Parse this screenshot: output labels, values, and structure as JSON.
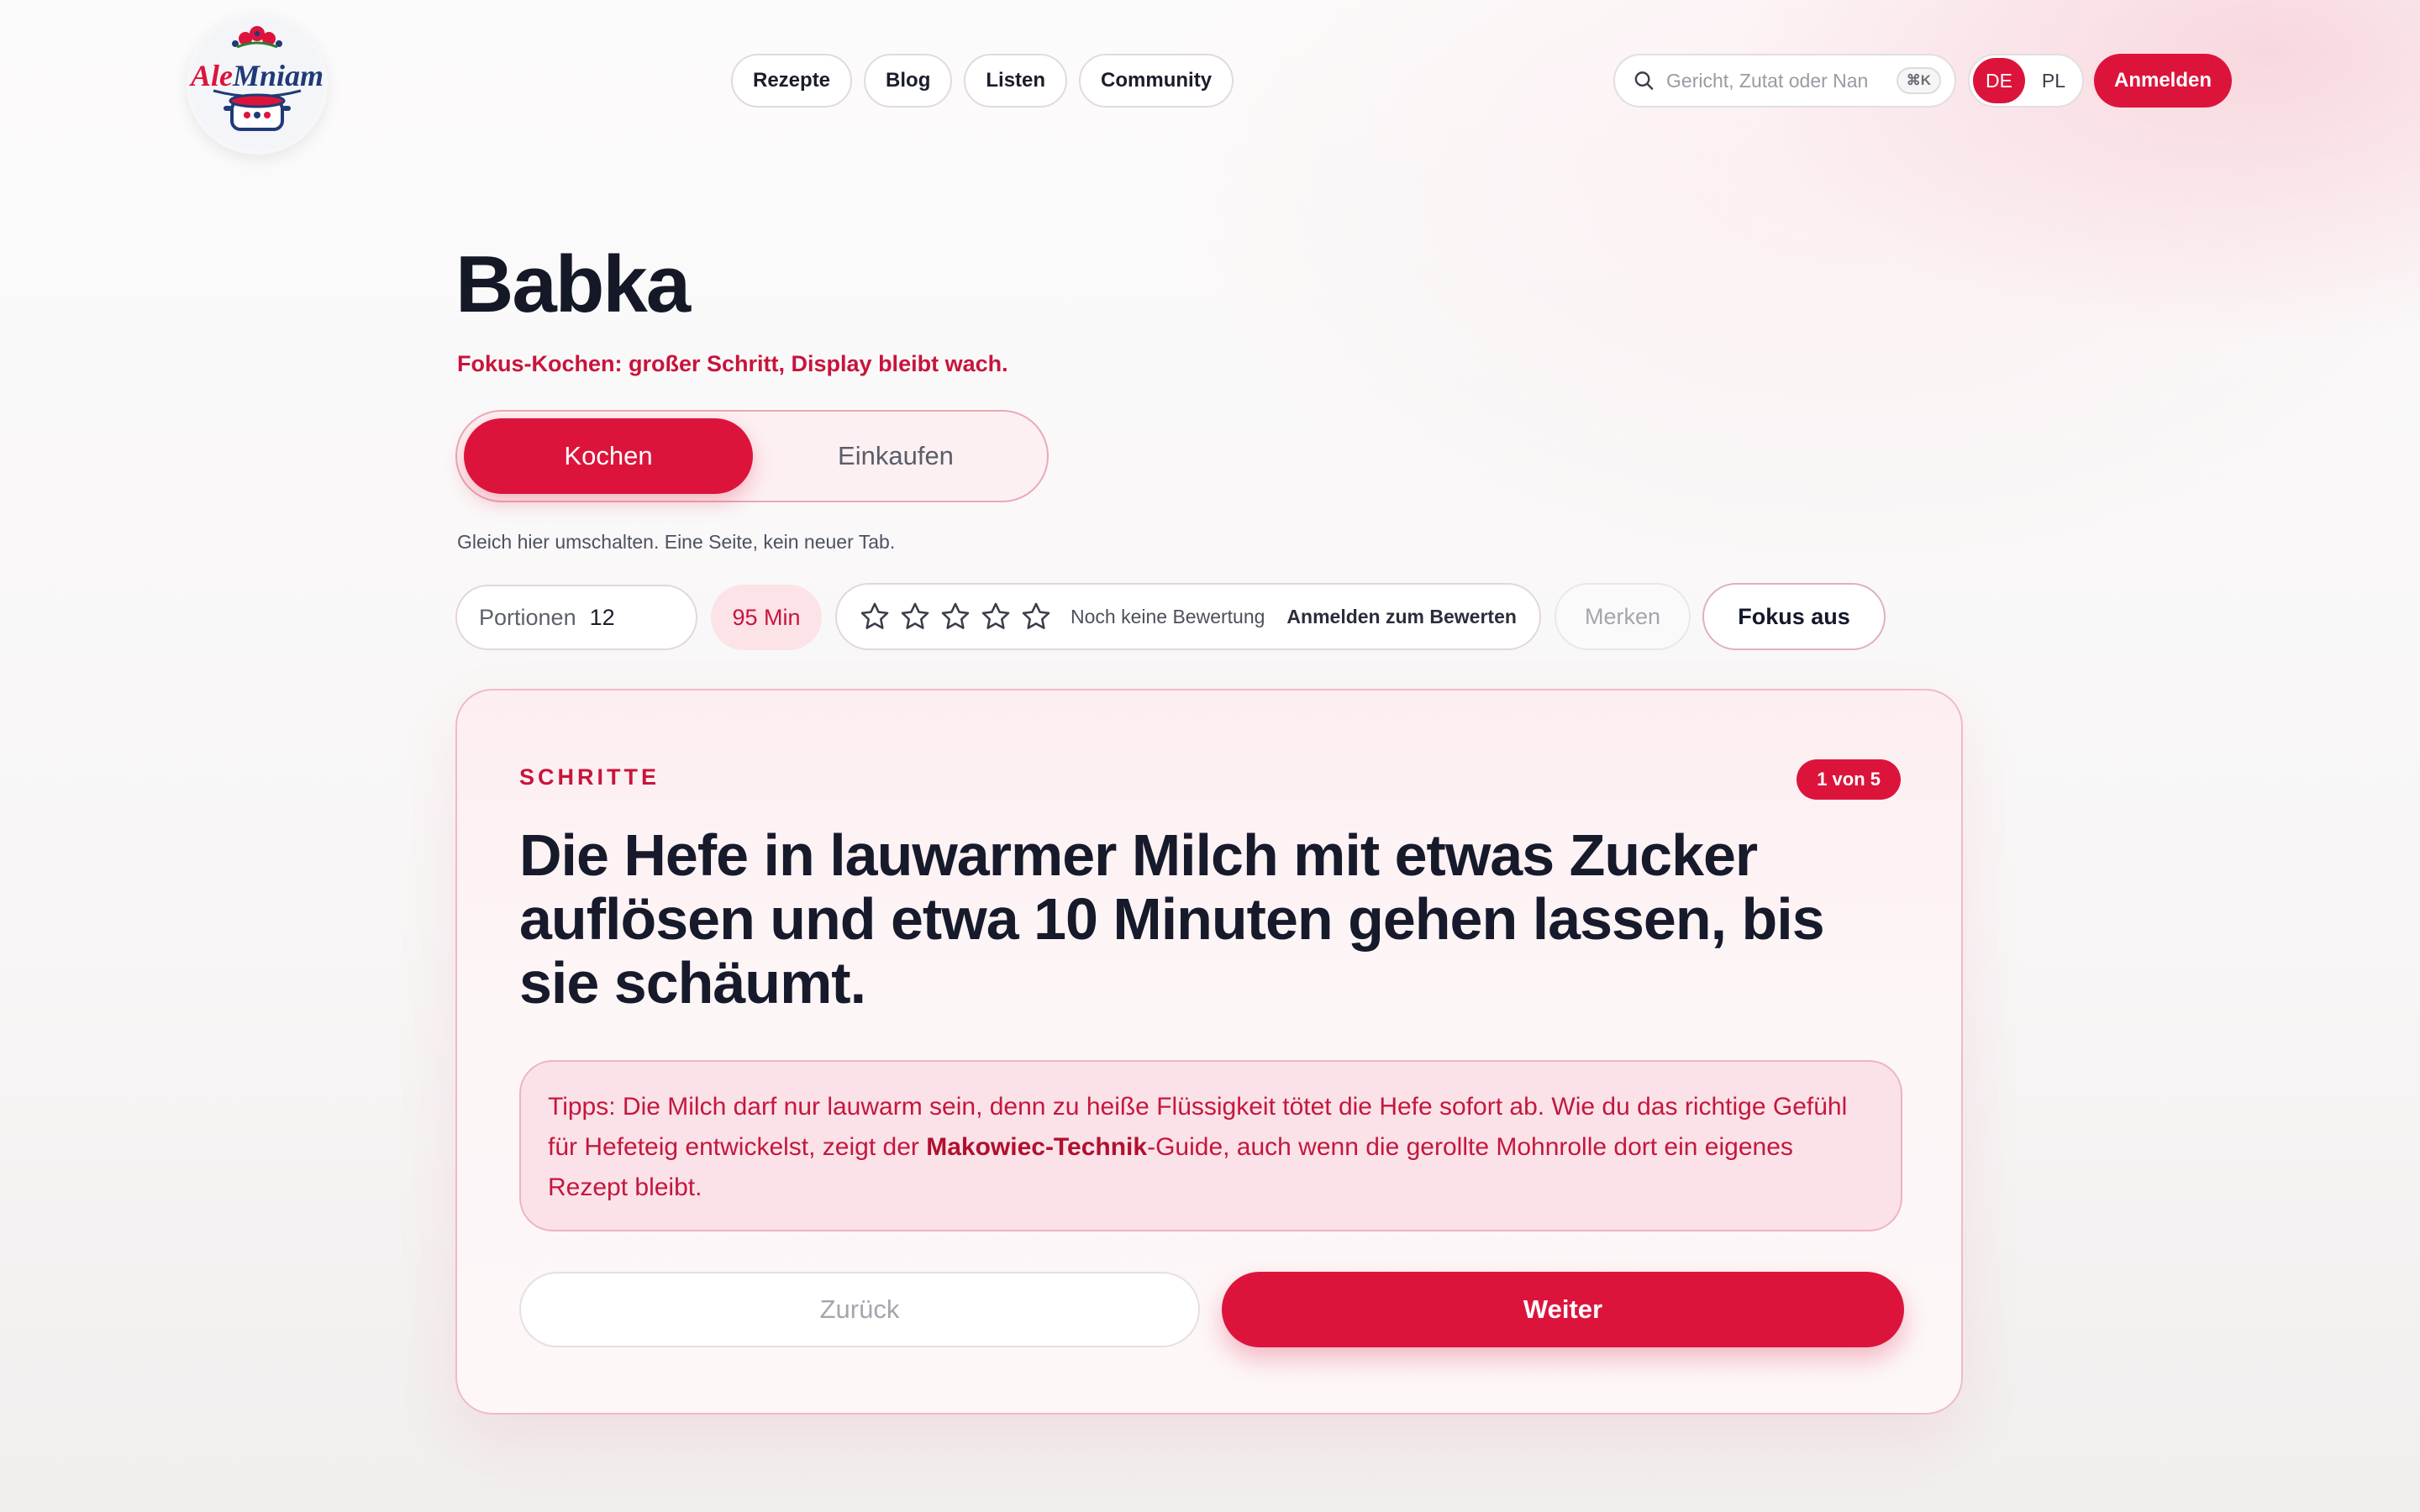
{
  "header": {
    "logo_text": "AleMniam",
    "nav": [
      {
        "label": "Rezepte"
      },
      {
        "label": "Blog"
      },
      {
        "label": "Listen"
      },
      {
        "label": "Community"
      }
    ],
    "search": {
      "placeholder": "Gericht, Zutat oder Nan",
      "shortcut": "⌘K"
    },
    "languages": {
      "active": "DE",
      "other": "PL"
    },
    "login_label": "Anmelden"
  },
  "recipe": {
    "title": "Babka",
    "subtitle": "Fokus-Kochen: großer Schritt, Display bleibt wach.",
    "modes": {
      "active": "Kochen",
      "inactive": "Einkaufen"
    },
    "hint": "Gleich hier umschalten. Eine Seite, kein neuer Tab.",
    "portions": {
      "label": "Portionen",
      "value": "12"
    },
    "time": "95 Min",
    "rating": {
      "stars_filled": 0,
      "stars_total": 5,
      "text": "Noch keine Bewertung",
      "login": "Anmelden zum Bewerten"
    },
    "save_label": "Merken",
    "focus_label": "Fokus aus"
  },
  "steps": {
    "label": "SCHRITTE",
    "badge": "1 von 5",
    "current_step": "Die Hefe in lauwarmer Milch mit etwas Zucker auflösen und etwa 10 Minuten gehen lassen, bis sie schäumt.",
    "tip": {
      "prefix": "Tipps: Die Milch darf nur lauwarm sein, denn zu heiße Flüssigkeit tötet die Hefe sofort ab. Wie du das richtige Gefühl für Hefeteig entwickelst, zeigt der ",
      "link": "Makowiec-Technik",
      "suffix": "-Guide, auch wenn die gerollte Mohnrolle dort ein eigenes Rezept bleibt."
    },
    "back_label": "Zurück",
    "next_label": "Weiter"
  },
  "colors": {
    "accent": "#dc143c",
    "accent_soft": "#fbe2e8",
    "text": "#14182a"
  }
}
